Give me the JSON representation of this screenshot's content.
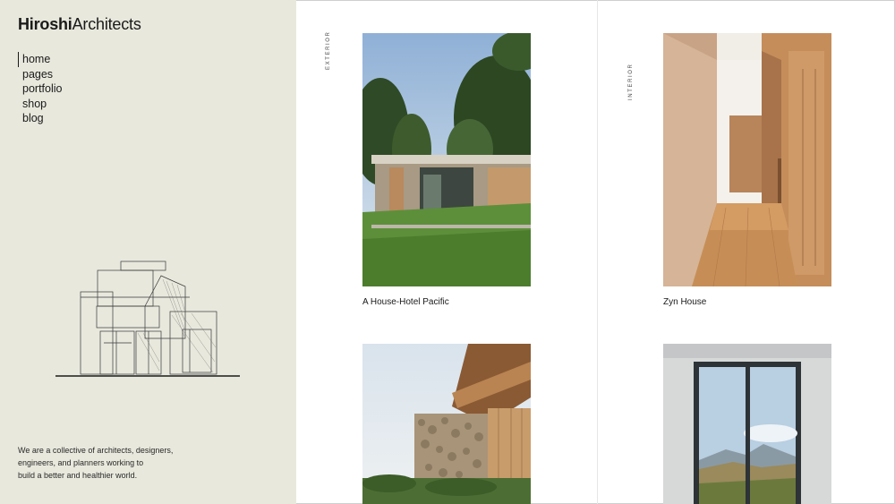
{
  "brand": {
    "bold": "Hiroshi",
    "light": "Architects"
  },
  "nav": [
    {
      "label": "home",
      "active": true
    },
    {
      "label": "pages",
      "active": false
    },
    {
      "label": "portfolio",
      "active": false
    },
    {
      "label": "shop",
      "active": false
    },
    {
      "label": "blog",
      "active": false
    }
  ],
  "about": {
    "line1": "We are a collective of architects, designers,",
    "line2": "engineers, and planners working to",
    "line3": "build a better and healthier world."
  },
  "columns": {
    "left_label": "EXTERIOR",
    "right_label": "INTERIOR"
  },
  "projects": [
    {
      "title": "A House-Hotel Pacific",
      "image": "house-exterior-photo"
    },
    {
      "title": "Zyn House",
      "image": "hallway-interior-photo"
    },
    {
      "title": "",
      "image": "stone-wall-exterior-photo"
    },
    {
      "title": "",
      "image": "window-mountain-view-photo"
    }
  ]
}
